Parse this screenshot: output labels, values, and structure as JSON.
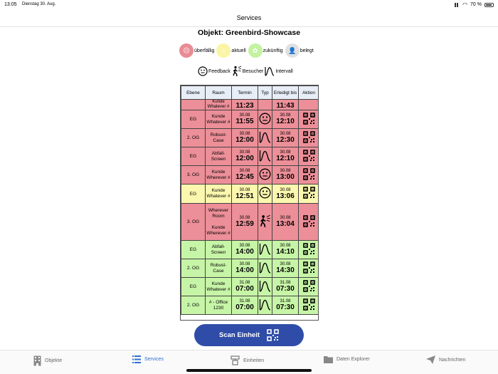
{
  "status": {
    "time": "13:05",
    "date": "Dienstag 30. Aug.",
    "battery": "70 %"
  },
  "nav": {
    "title": "Services"
  },
  "objekt": "Objekt: Greenbird-Showcase",
  "legend": [
    {
      "label": "überfällig",
      "color": "#e88c94"
    },
    {
      "label": "aktuell",
      "color": "#faf5a4"
    },
    {
      "label": "zukünftig",
      "color": "#c3f2a0"
    },
    {
      "label": "belegt",
      "color": "#e0e0e0"
    }
  ],
  "types": [
    {
      "label": "Feedback",
      "icon": "smiley-icon"
    },
    {
      "label": "Besucher",
      "icon": "walker-icon"
    },
    {
      "label": "Intervall",
      "icon": "bell-curve-icon"
    }
  ],
  "table": {
    "headers": [
      "Ebene",
      "Raum",
      "Termin",
      "Typ",
      "Erledigt bis",
      "Aktion"
    ],
    "partial": {
      "raum": "Kunde Whatever #",
      "termin": "11:23",
      "erledigt": "11:43",
      "status": "overdue"
    },
    "rows": [
      {
        "ebene": "EG",
        "raum": "Kunde Whatever #",
        "d1": "30.08",
        "t1": "11:55",
        "typ": "feedback",
        "d2": "30.08",
        "t2": "12:10",
        "status": "overdue"
      },
      {
        "ebene": "2. OG",
        "raum": "Robust-Case",
        "d1": "30.08",
        "t1": "12:00",
        "typ": "interval",
        "d2": "30.08",
        "t2": "12:30",
        "status": "overdue"
      },
      {
        "ebene": "EG",
        "raum": "Abfall-Screen",
        "d1": "30.08",
        "t1": "12:00",
        "typ": "interval",
        "d2": "30.08",
        "t2": "12:10",
        "status": "overdue"
      },
      {
        "ebene": "3. OG",
        "raum": "Kunde Wherever #",
        "d1": "30.08",
        "t1": "12:45",
        "typ": "feedback",
        "d2": "30.08",
        "t2": "13:00",
        "status": "overdue"
      },
      {
        "ebene": "EG",
        "raum": "Kunde Whatever #",
        "d1": "30.08",
        "t1": "12:51",
        "typ": "feedback",
        "d2": "30.08",
        "t2": "13:06",
        "status": "current"
      },
      {
        "ebene": "3. OG",
        "raum": "Wherever Room\n\nKunde Wherever #",
        "d1": "30.08",
        "t1": "12:59",
        "typ": "visitor",
        "d2": "30.08",
        "t2": "13:04",
        "status": "overdue"
      },
      {
        "ebene": "EG",
        "raum": "Abfall-Screen",
        "d1": "30.08",
        "t1": "14:00",
        "typ": "interval",
        "d2": "30.08",
        "t2": "14:10",
        "status": "future"
      },
      {
        "ebene": "2. OG",
        "raum": "Robust-Case",
        "d1": "30.08",
        "t1": "14:00",
        "typ": "interval",
        "d2": "30.08",
        "t2": "14:30",
        "status": "future"
      },
      {
        "ebene": "EG",
        "raum": "Kunde Whatever #",
        "d1": "31.08",
        "t1": "07:00",
        "typ": "interval",
        "d2": "31.08",
        "t2": "07:30",
        "status": "future"
      },
      {
        "ebene": "2. OG",
        "raum": "# - Office 1230",
        "d1": "31.08",
        "t1": "07:00",
        "typ": "interval",
        "d2": "31.08",
        "t2": "07:30",
        "status": "future"
      }
    ]
  },
  "scan_button": {
    "label": "Scan Einheit"
  },
  "tabs": [
    {
      "label": "Objekte",
      "icon": "building-icon",
      "active": false
    },
    {
      "label": "Services",
      "icon": "list-icon",
      "active": true
    },
    {
      "label": "Einheiten",
      "icon": "units-icon",
      "active": false
    },
    {
      "label": "Daten Explorer",
      "icon": "folder-icon",
      "active": false
    },
    {
      "label": "Nachrichten",
      "icon": "paperplane-icon",
      "active": false
    }
  ]
}
